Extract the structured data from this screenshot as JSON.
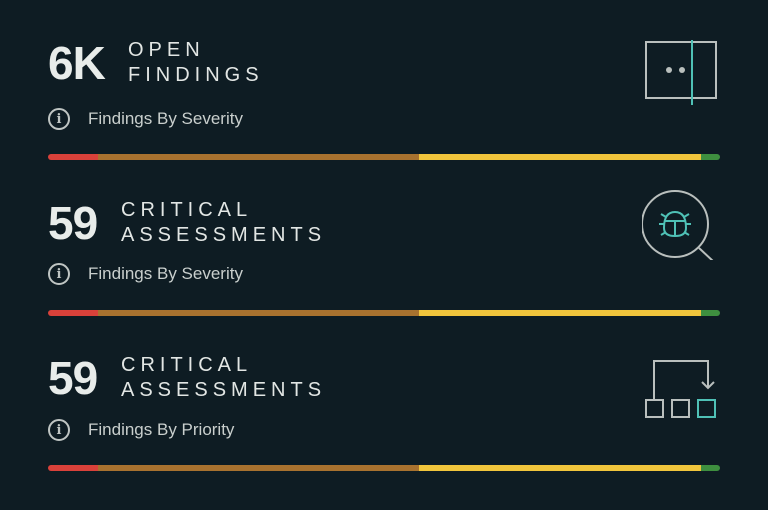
{
  "colors": {
    "background": "#0e1c23",
    "red": "#d9413a",
    "brown": "#a8722f",
    "yellow": "#f0c53c",
    "green": "#3e8f3f",
    "accent": "#4fc1b6"
  },
  "cards": [
    {
      "value": "6K",
      "label1": "OPEN",
      "label2": "FINDINGS",
      "subtitle": "Findings By Severity",
      "icon": "window-split-icon",
      "segments": [
        7.4,
        47.8,
        42,
        2.8
      ]
    },
    {
      "value": "59",
      "label1": "CRITICAL",
      "label2": "ASSESSMENTS",
      "subtitle": "Findings By Severity",
      "icon": "bug-search-icon",
      "segments": [
        7.4,
        47.8,
        42,
        2.8
      ]
    },
    {
      "value": "59",
      "label1": "CRITICAL",
      "label2": "ASSESSMENTS",
      "subtitle": "Findings By Priority",
      "icon": "workflow-icon",
      "segments": [
        7.4,
        47.8,
        42,
        2.8
      ]
    }
  ]
}
